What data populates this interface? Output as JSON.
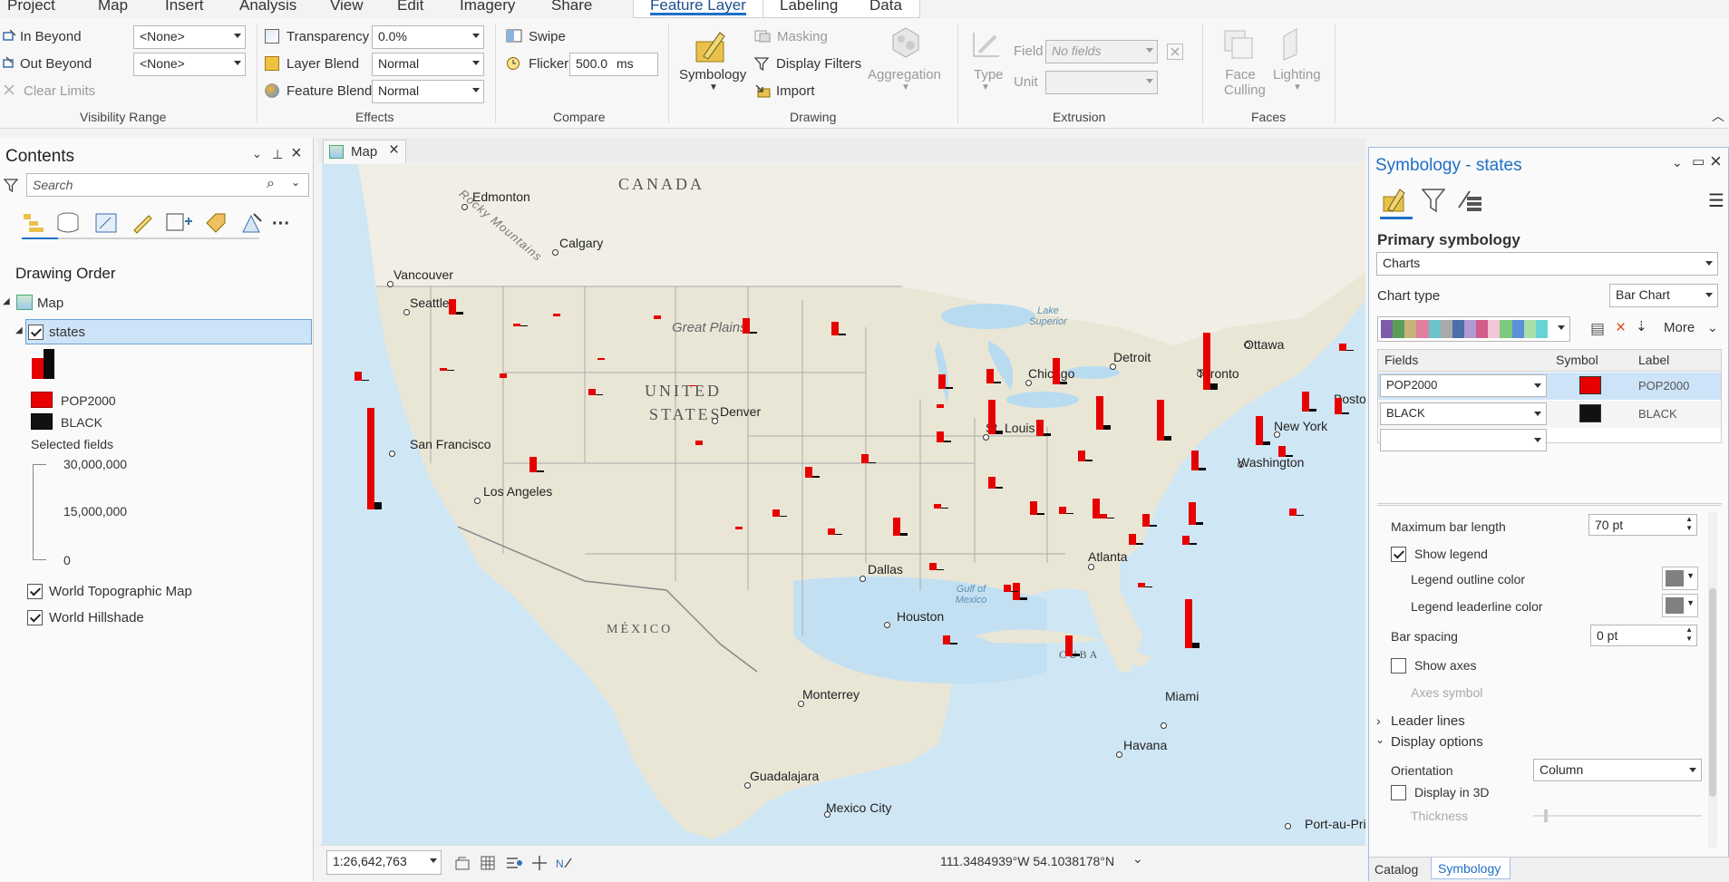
{
  "ribbon": {
    "tabs": [
      "Project",
      "Map",
      "Insert",
      "Analysis",
      "View",
      "Edit",
      "Imagery",
      "Share",
      "Feature Layer",
      "Labeling",
      "Data"
    ],
    "visibility": {
      "in_beyond": "In Beyond",
      "out_beyond": "Out Beyond",
      "in_value": "<None>",
      "out_value": "<None>",
      "clear_limits": "Clear Limits",
      "group": "Visibility Range"
    },
    "effects": {
      "transparency": "Transparency",
      "transparency_value": "0.0%",
      "layer_blend": "Layer Blend",
      "layer_blend_value": "Normal",
      "feature_blend": "Feature Blend",
      "feature_blend_value": "Normal",
      "group": "Effects"
    },
    "compare": {
      "swipe": "Swipe",
      "flicker": "Flicker",
      "flicker_value": "500.0",
      "flicker_unit": "ms",
      "group": "Compare"
    },
    "drawing": {
      "symbology": "Symbology",
      "masking": "Masking",
      "display_filters": "Display Filters",
      "import": "Import",
      "aggregation": "Aggregation",
      "group": "Drawing"
    },
    "extrusion": {
      "type": "Type",
      "field": "Field",
      "field_value": "No fields",
      "unit": "Unit",
      "group": "Extrusion"
    },
    "faces": {
      "face_culling": "Face Culling",
      "lighting": "Lighting",
      "group": "Faces"
    }
  },
  "contents": {
    "title": "Contents",
    "search_placeholder": "Search",
    "drawing_order": "Drawing Order",
    "map_item": "Map",
    "layer": "states",
    "legend_fields": [
      "POP2000",
      "BLACK"
    ],
    "selected_fields": "Selected fields",
    "scale_labels": [
      "30,000,000",
      "15,000,000",
      "0"
    ],
    "basemaps": [
      "World Topographic Map",
      "World Hillshade"
    ]
  },
  "map": {
    "tab": "Map",
    "scale": "1:26,642,763",
    "coords": "111.3484939°W 54.1038178°N",
    "countries": [
      "CANADA",
      "UNITED",
      "STATES",
      "MÉXICO",
      "CUBA"
    ],
    "features": [
      "Rocky Mountains",
      "Great Plains",
      "Lake Superior",
      "Gulf of Mexico"
    ],
    "cities": [
      "Edmonton",
      "Calgary",
      "Vancouver",
      "Seattle",
      "San Francisco",
      "Los Angeles",
      "Denver",
      "Dallas",
      "Houston",
      "Monterrey",
      "Guadalajara",
      "Mexico City",
      "Chicago",
      "St. Louis",
      "Detroit",
      "Toronto",
      "Ottawa",
      "Boston",
      "New York",
      "Washington",
      "Atlanta",
      "Miami",
      "Havana",
      "Port-au-Pri"
    ]
  },
  "symbology": {
    "title": "Symbology - states",
    "primary": "Primary symbology",
    "renderer": "Charts",
    "chart_type_label": "Chart type",
    "chart_type": "Bar Chart",
    "more": "More",
    "headers": [
      "Fields",
      "Symbol",
      "Label"
    ],
    "rows": [
      {
        "field": "POP2000",
        "label": "POP2000",
        "color": "#e60000"
      },
      {
        "field": "BLACK",
        "label": "BLACK",
        "color": "#111111"
      }
    ],
    "max_bar_length_label": "Maximum bar length",
    "max_bar_length": "70 pt",
    "show_legend": "Show legend",
    "legend_outline": "Legend outline color",
    "legend_leader": "Legend leaderline color",
    "bar_spacing_label": "Bar spacing",
    "bar_spacing": "0 pt",
    "show_axes": "Show axes",
    "axes_symbol": "Axes symbol",
    "leader_lines": "Leader lines",
    "display_options": "Display options",
    "orientation_label": "Orientation",
    "orientation": "Column",
    "display_3d": "Display in 3D",
    "thickness": "Thickness",
    "bottom_tabs": [
      "Catalog",
      "Symbology"
    ]
  }
}
